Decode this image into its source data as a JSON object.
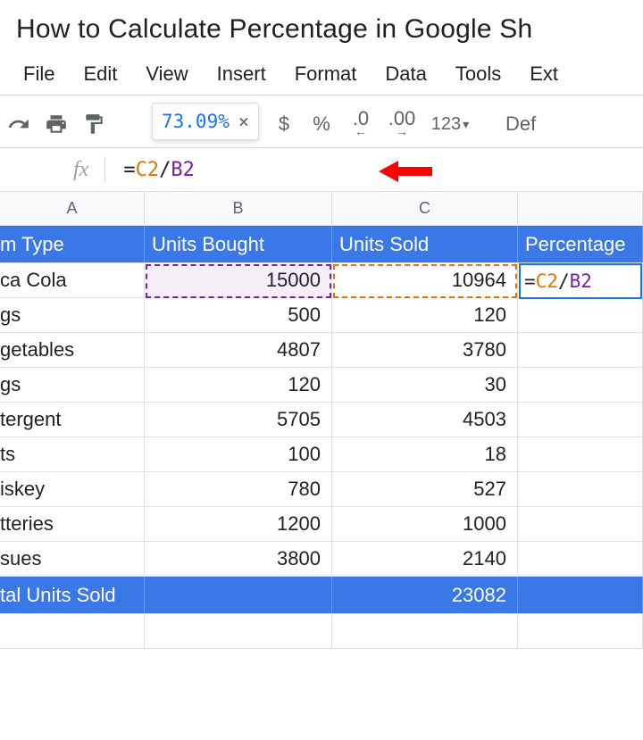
{
  "page_title": "How to Calculate Percentage in Google Sh",
  "menubar": {
    "items": [
      "File",
      "Edit",
      "View",
      "Insert",
      "Format",
      "Data",
      "Tools",
      "Ext"
    ]
  },
  "tooltip": {
    "value": "73.09%"
  },
  "toolbar": {
    "currency": "$",
    "percent": "%",
    "dec_dec": ".0",
    "dec_inc": ".00",
    "num_fmt": "123",
    "font_trunc": "Def"
  },
  "formula_bar": {
    "fx_label": "fx",
    "formula": {
      "ref1": "C2",
      "ref2": "B2"
    }
  },
  "columns": {
    "A": "A",
    "B": "B",
    "C": "C"
  },
  "header_row": {
    "a": "m Type",
    "b": "Units Bought",
    "c": "Units Sold",
    "d": "Percentage"
  },
  "rows": [
    {
      "a": "ca Cola",
      "b": "15000",
      "c": "10964"
    },
    {
      "a": "gs",
      "b": "500",
      "c": "120"
    },
    {
      "a": "getables",
      "b": "4807",
      "c": "3780"
    },
    {
      "a": "gs",
      "b": "120",
      "c": "30"
    },
    {
      "a": "tergent",
      "b": "5705",
      "c": "4503"
    },
    {
      "a": "ts",
      "b": "100",
      "c": "18"
    },
    {
      "a": "iskey",
      "b": "780",
      "c": "527"
    },
    {
      "a": "tteries",
      "b": "1200",
      "c": "1000"
    },
    {
      "a": "sues",
      "b": "3800",
      "c": "2140"
    }
  ],
  "total_row": {
    "a": "tal Units Sold",
    "b": "",
    "c": "23082"
  },
  "editing_cell": {
    "ref1": "C2",
    "ref2": "B2"
  },
  "chart_data": {
    "type": "table",
    "title": "How to Calculate Percentage in Google Sheets",
    "columns": [
      "Item Type (truncated)",
      "Units Bought",
      "Units Sold",
      "Percentage Sold"
    ],
    "rows": [
      [
        "ca Cola",
        15000,
        10964,
        "=C2/B2"
      ],
      [
        "gs",
        500,
        120,
        null
      ],
      [
        "getables",
        4807,
        3780,
        null
      ],
      [
        "gs",
        120,
        30,
        null
      ],
      [
        "tergent",
        5705,
        4503,
        null
      ],
      [
        "ts",
        100,
        18,
        null
      ],
      [
        "iskey",
        780,
        527,
        null
      ],
      [
        "tteries",
        1200,
        1000,
        null
      ],
      [
        "sues",
        3800,
        2140,
        null
      ]
    ],
    "totals": {
      "label": "tal Units Sold",
      "units_sold": 23082
    },
    "formula_preview": "73.09%"
  }
}
